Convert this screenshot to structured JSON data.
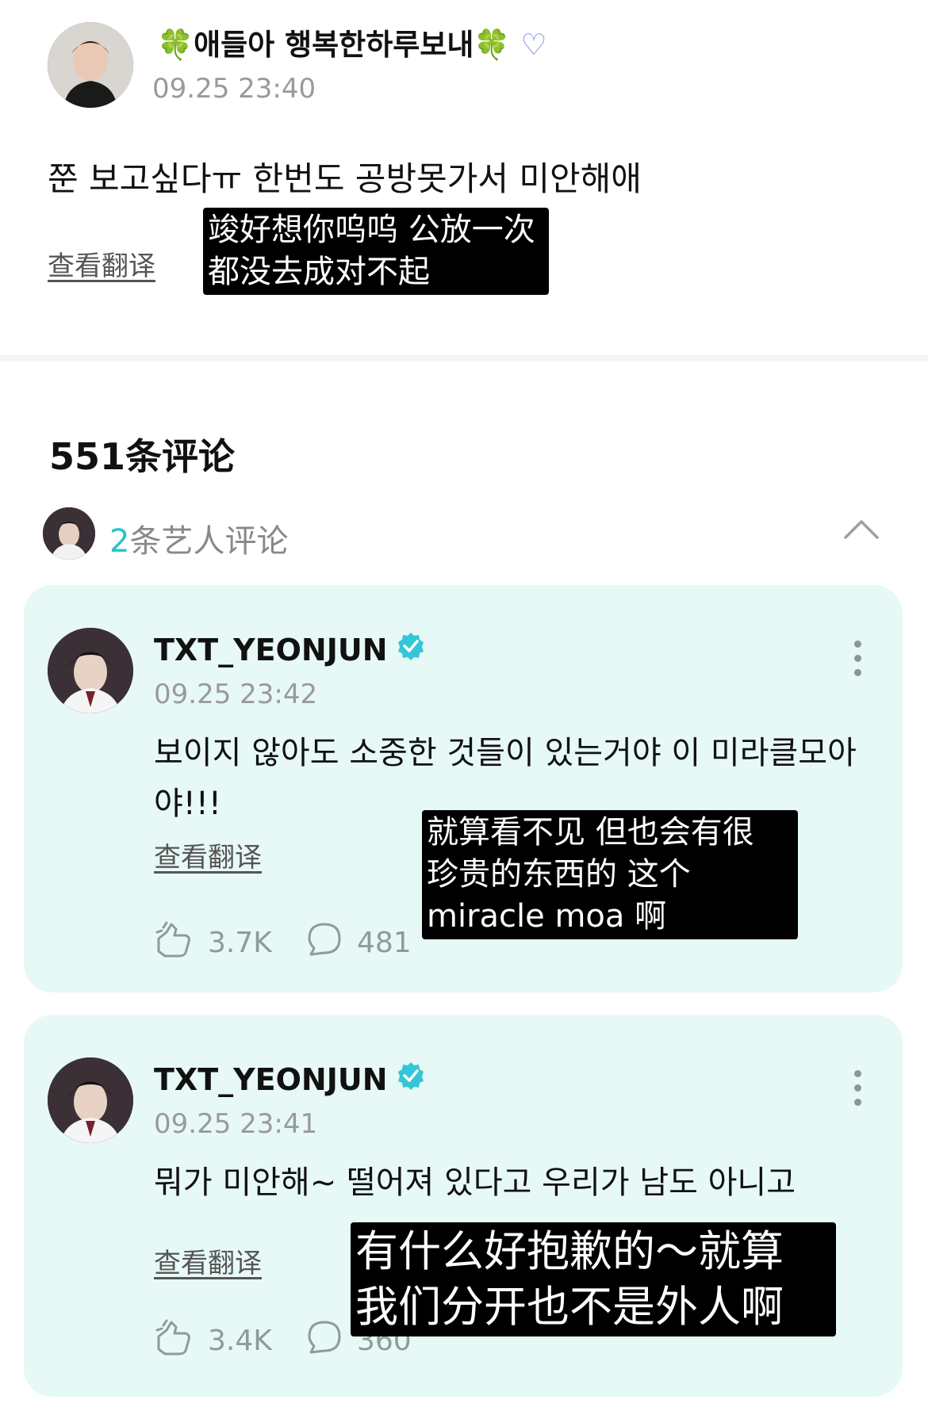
{
  "post": {
    "author": "애들아 행복한하루보내",
    "clover_glyph": "🍀",
    "heart_glyph": "♡",
    "timestamp": "09.25 23:40",
    "body": "쭌 보고싶다ㅠ 한번도 공방못가서 미안해애",
    "translate_label": "查看翻译",
    "overlay_translation": "竣好想你呜呜 公放一次\n都没去成对不起"
  },
  "comments_section": {
    "title": "551条评论",
    "artist_comments": {
      "count": "2",
      "label": "条艺人评论",
      "toggle_icon": "chevron-up-icon"
    }
  },
  "comments": [
    {
      "author": "TXT_YEONJUN",
      "timestamp": "09.25 23:42",
      "body": "보이지 않아도 소중한 것들이 있는거야 이 미라클모아야!!!",
      "translate_label": "查看翻译",
      "likes": "3.7K",
      "replies": "481",
      "overlay_translation": "就算看不见 但也会有很\n珍贵的东西的 这个\nmiracle moa 啊"
    },
    {
      "author": "TXT_YEONJUN",
      "timestamp": "09.25 23:41",
      "body": "뭐가 미안해~ 떨어져 있다고 우리가 남도 아니고",
      "translate_label": "查看翻译",
      "likes": "3.4K",
      "replies": "360",
      "overlay_translation": "有什么好抱歉的～就算\n我们分开也不是外人啊"
    }
  ],
  "colors": {
    "accent": "#29c4c4",
    "card_bg": "#e7f9f6",
    "verified": "#33c6d6"
  }
}
